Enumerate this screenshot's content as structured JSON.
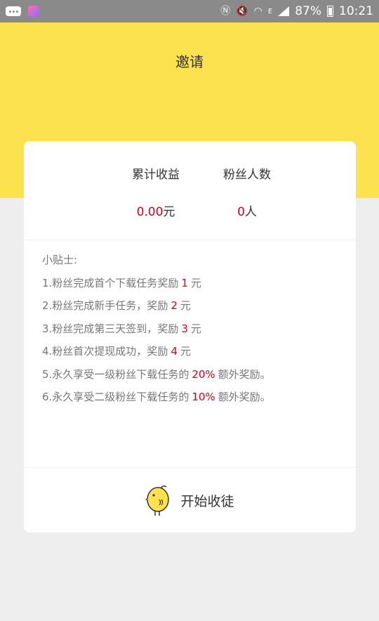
{
  "status_bar": {
    "battery": "87%",
    "time": "10:21",
    "network": "E"
  },
  "page": {
    "title": "邀请"
  },
  "stats": {
    "earnings_label": "累计收益",
    "earnings_value": "0.00",
    "earnings_unit": "元",
    "fans_label": "粉丝人数",
    "fans_value": "0",
    "fans_unit": "人"
  },
  "tips": {
    "title": "小贴士:",
    "items": [
      {
        "before": "1.粉丝完成首个下载任务奖励",
        "value": "1",
        "after": "元"
      },
      {
        "before": "2.粉丝完成新手任务，奖励",
        "value": "2",
        "after": "元"
      },
      {
        "before": "3.粉丝完成第三天签到，奖励",
        "value": "3",
        "after": "元"
      },
      {
        "before": "4.粉丝首次提现成功，奖励",
        "value": "4",
        "after": "元"
      },
      {
        "before": "5.永久享受一级粉丝下载任务的",
        "value": "20%",
        "after": "额外奖励。"
      },
      {
        "before": "6.永久享受二级粉丝下载任务的",
        "value": "10%",
        "after": "额外奖励。"
      }
    ]
  },
  "action": {
    "label": "开始收徒",
    "icon": "chick-icon"
  },
  "colors": {
    "header": "#fbe24e",
    "accent": "#d0021b",
    "status_bar": "#8a8a8a"
  }
}
